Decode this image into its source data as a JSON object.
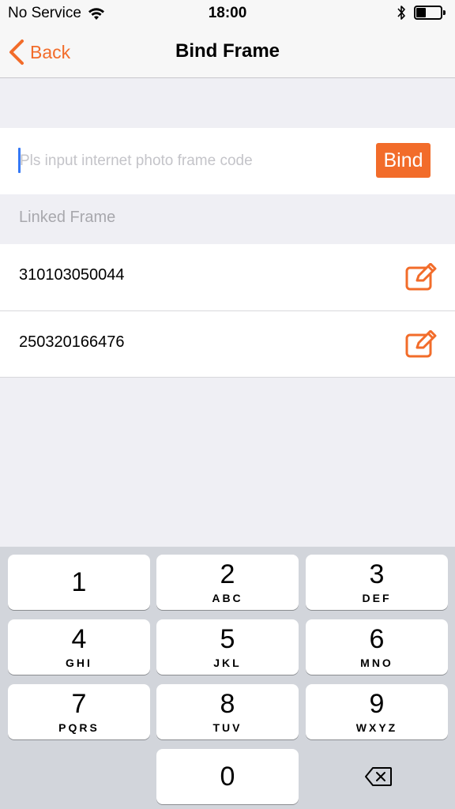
{
  "status_bar": {
    "carrier": "No Service",
    "time": "18:00"
  },
  "nav": {
    "back_label": "Back",
    "title": "Bind Frame"
  },
  "bind": {
    "placeholder": "Pls input internet photo frame code",
    "value": "",
    "button_label": "Bind"
  },
  "linked_section": {
    "header": "Linked Frame",
    "frames": [
      {
        "code": "310103050044"
      },
      {
        "code": "250320166476"
      }
    ]
  },
  "keyboard": {
    "keys": [
      {
        "digit": "1",
        "letters": ""
      },
      {
        "digit": "2",
        "letters": "ABC"
      },
      {
        "digit": "3",
        "letters": "DEF"
      },
      {
        "digit": "4",
        "letters": "GHI"
      },
      {
        "digit": "5",
        "letters": "JKL"
      },
      {
        "digit": "6",
        "letters": "MNO"
      },
      {
        "digit": "7",
        "letters": "PQRS"
      },
      {
        "digit": "8",
        "letters": "TUV"
      },
      {
        "digit": "9",
        "letters": "WXYZ"
      },
      {
        "digit": "0",
        "letters": ""
      }
    ]
  },
  "colors": {
    "accent": "#f26c2a",
    "background": "#efeff4",
    "keyboard_bg": "#d2d5db"
  },
  "icons": {
    "back": "chevron-left-icon",
    "wifi": "wifi-icon",
    "bluetooth": "bluetooth-icon",
    "battery": "battery-icon",
    "edit": "edit-icon",
    "delete": "delete-backspace-icon"
  }
}
